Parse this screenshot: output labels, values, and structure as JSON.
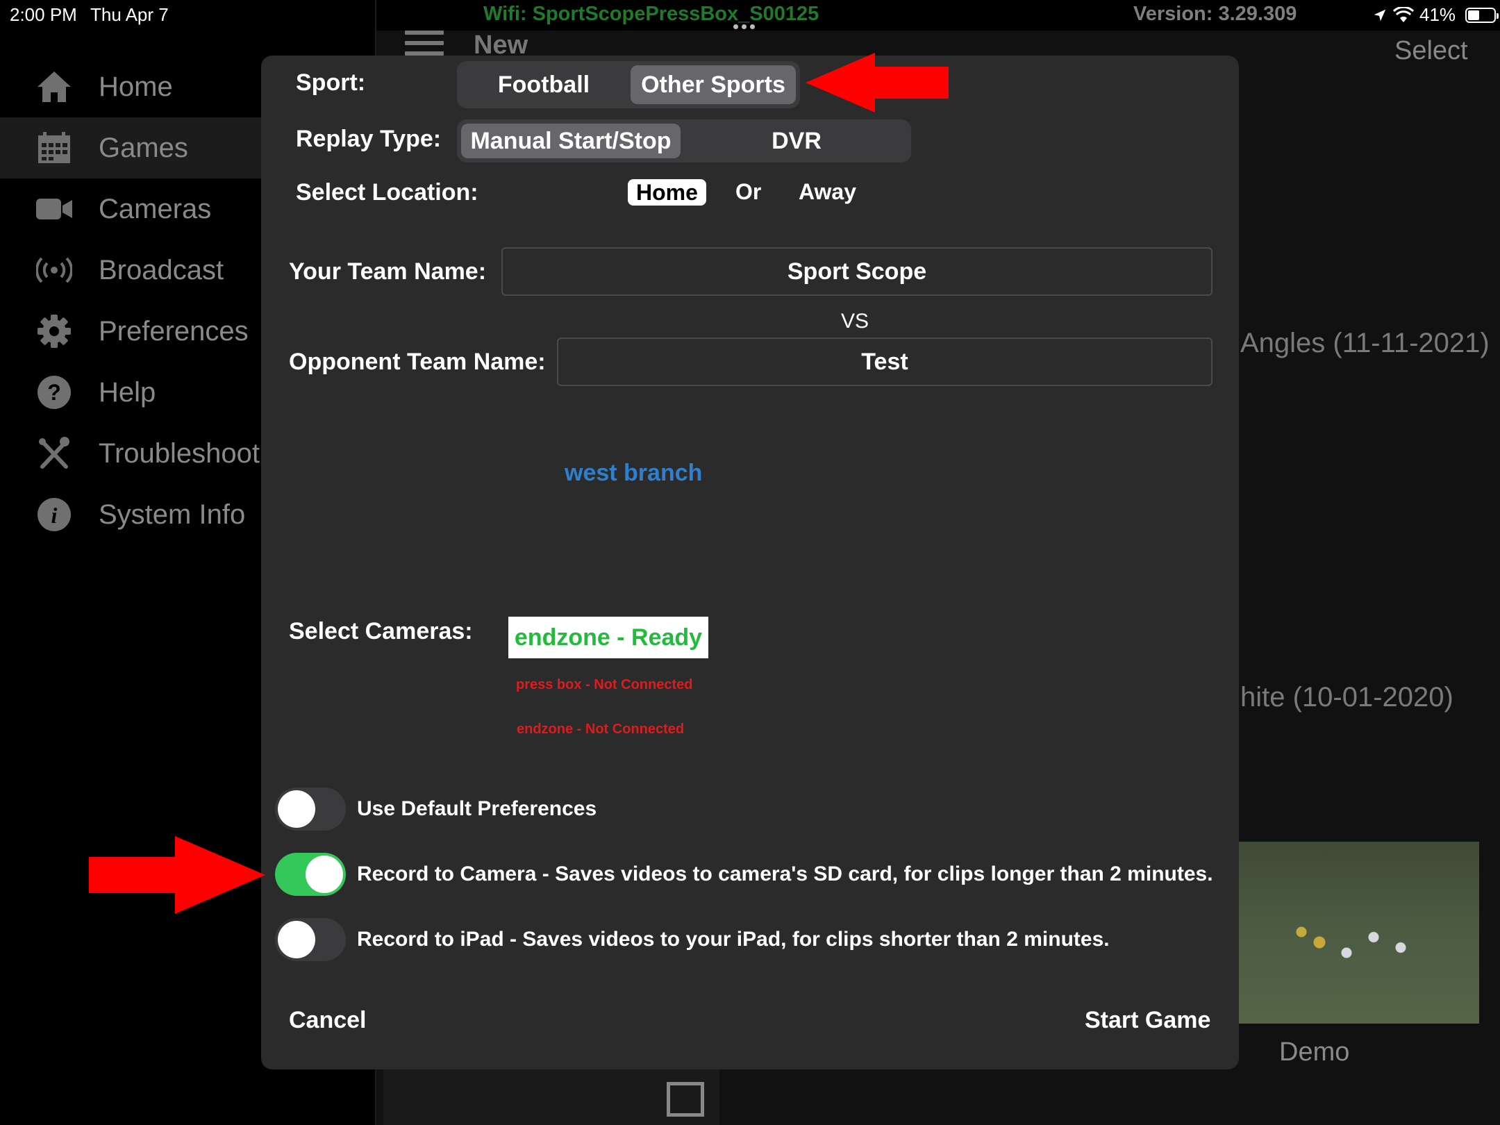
{
  "status_bar": {
    "time": "2:00 PM",
    "date": "Thu Apr 7",
    "wifi": "Wifi: SportScopePressBox_S00125",
    "version": "Version: 3.29.309",
    "battery": "41%"
  },
  "sidebar": {
    "items": [
      {
        "label": "Home",
        "icon": "home-icon"
      },
      {
        "label": "Games",
        "icon": "calendar-icon"
      },
      {
        "label": "Cameras",
        "icon": "video-camera-icon"
      },
      {
        "label": "Broadcast",
        "icon": "broadcast-icon"
      },
      {
        "label": "Preferences",
        "icon": "gear-icon"
      },
      {
        "label": "Help",
        "icon": "question-icon"
      },
      {
        "label": "Troubleshoot",
        "icon": "tools-icon"
      },
      {
        "label": "System Info",
        "icon": "info-icon"
      }
    ],
    "active_index": 1
  },
  "background": {
    "title": "New",
    "select": "Select",
    "game_1": "Angles (11-11-2021)",
    "game_2": "hite (10-01-2020)",
    "demo": "Demo"
  },
  "modal": {
    "sport_label": "Sport:",
    "sport_options": [
      "Football",
      "Other Sports"
    ],
    "sport_selected": "Other Sports",
    "replay_label": "Replay Type:",
    "replay_options": [
      "Manual Start/Stop",
      "DVR"
    ],
    "replay_selected": "Manual Start/Stop",
    "location_label": "Select Location:",
    "location_home": "Home",
    "location_or": "Or",
    "location_away": "Away",
    "team_label": "Your Team Name:",
    "team_value": "Sport Scope",
    "vs": "VS",
    "opponent_label": "Opponent Team Name:",
    "opponent_value": "Test",
    "location_name": "west branch",
    "cameras_label": "Select Cameras:",
    "cameras": [
      {
        "label": "endzone - Ready",
        "status": "ready"
      },
      {
        "label": "press box - Not Connected",
        "status": "not_connected"
      },
      {
        "label": "endzone - Not Connected",
        "status": "not_connected"
      }
    ],
    "toggles": [
      {
        "label": "Use Default Preferences",
        "on": false
      },
      {
        "label": "Record to Camera - Saves videos to camera's SD card, for clips longer than 2 minutes.",
        "on": true
      },
      {
        "label": "Record to iPad - Saves videos to your iPad, for clips shorter than 2 minutes.",
        "on": false
      }
    ],
    "cancel": "Cancel",
    "start": "Start Game"
  },
  "colors": {
    "accent_green": "#34c759",
    "ready_green": "#22bb3c",
    "error_red": "#e01b1b",
    "link_blue": "#2d7fd0",
    "annotation_arrow": "#ff0000"
  }
}
